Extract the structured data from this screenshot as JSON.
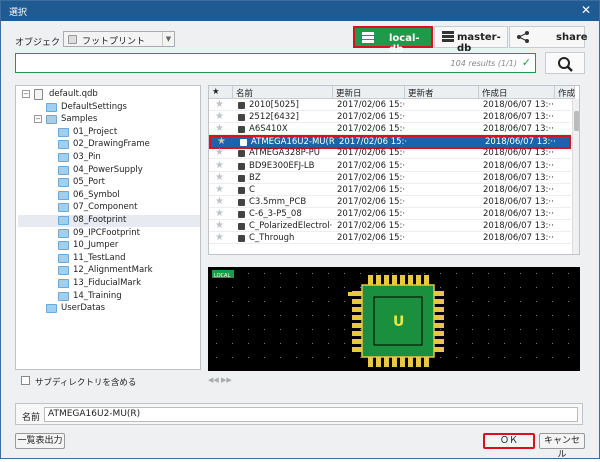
{
  "window": {
    "title": "選択",
    "close_glyph": "✕"
  },
  "object": {
    "label": "オブジェクト",
    "value": "フットプリント"
  },
  "db_buttons": {
    "local": {
      "label": "local-db",
      "sub": "LOCAL"
    },
    "master": {
      "label": "master-db",
      "sub": "MASTER"
    },
    "share": {
      "label": "share"
    }
  },
  "search": {
    "value": "",
    "result_count": "104 results (1/1)"
  },
  "tree": {
    "items": [
      {
        "label": "default.qdb",
        "level": 0,
        "kind": "db",
        "toggle": "−"
      },
      {
        "label": "DefaultSettings",
        "level": 1,
        "kind": "folder"
      },
      {
        "label": "Samples",
        "level": 1,
        "kind": "folder",
        "toggle": "−"
      },
      {
        "label": "01_Project",
        "level": 2,
        "kind": "folder"
      },
      {
        "label": "02_DrawingFrame",
        "level": 2,
        "kind": "folder"
      },
      {
        "label": "03_Pin",
        "level": 2,
        "kind": "folder"
      },
      {
        "label": "04_PowerSupply",
        "level": 2,
        "kind": "folder"
      },
      {
        "label": "05_Port",
        "level": 2,
        "kind": "folder"
      },
      {
        "label": "06_Symbol",
        "level": 2,
        "kind": "folder"
      },
      {
        "label": "07_Component",
        "level": 2,
        "kind": "folder"
      },
      {
        "label": "08_Footprint",
        "level": 2,
        "kind": "folder",
        "selected": true
      },
      {
        "label": "09_IPCFootprint",
        "level": 2,
        "kind": "folder"
      },
      {
        "label": "10_Jumper",
        "level": 2,
        "kind": "folder"
      },
      {
        "label": "11_TestLand",
        "level": 2,
        "kind": "folder"
      },
      {
        "label": "12_AlignmentMark",
        "level": 2,
        "kind": "folder"
      },
      {
        "label": "13_FiducialMark",
        "level": 2,
        "kind": "folder"
      },
      {
        "label": "14_Training",
        "level": 2,
        "kind": "folder"
      },
      {
        "label": "UserDatas",
        "level": 1,
        "kind": "folder"
      }
    ]
  },
  "subdir": {
    "label": "サブディレクトリを含める"
  },
  "table": {
    "headers": [
      "★",
      "名前",
      "更新日",
      "更新者",
      "作成日",
      "作成"
    ],
    "rows": [
      {
        "name": "2010[5025]",
        "updated": "2017/02/06 15:···",
        "updater": "",
        "created": "2018/06/07 13:···"
      },
      {
        "name": "2512[6432]",
        "updated": "2017/02/06 15:···",
        "updater": "",
        "created": "2018/06/07 13:···"
      },
      {
        "name": "A6S410X",
        "updated": "2017/02/06 15:···",
        "updater": "",
        "created": "2018/06/07 13:···"
      },
      {
        "name": "ATMEGA16U2-MU(R)",
        "updated": "2017/02/06 15:···",
        "updater": "",
        "created": "2018/06/07 13:···",
        "selected": true
      },
      {
        "name": "ATMEGA328P-PU",
        "updated": "2017/02/06 15:···",
        "updater": "",
        "created": "2018/06/07 13:···"
      },
      {
        "name": "BD9E300EFJ-LB",
        "updated": "2017/02/06 15:···",
        "updater": "",
        "created": "2018/06/07 13:···"
      },
      {
        "name": "BZ",
        "updated": "2017/02/06 15:···",
        "updater": "",
        "created": "2018/06/07 13:···"
      },
      {
        "name": "C",
        "updated": "2017/02/06 15:···",
        "updater": "",
        "created": "2018/06/07 13:···"
      },
      {
        "name": "C3.5mm_PCB",
        "updated": "2017/02/06 15:···",
        "updater": "",
        "created": "2018/06/07 13:···"
      },
      {
        "name": "C-6_3-P5_08",
        "updated": "2017/02/06 15:···",
        "updater": "",
        "created": "2018/06/07 13:···"
      },
      {
        "name": "C_PolarizedElectrol···",
        "updated": "2017/02/06 15:···",
        "updater": "",
        "created": "2018/06/07 13:···"
      },
      {
        "name": "C_Through",
        "updated": "2017/02/06 15:···",
        "updater": "",
        "created": "2018/06/07 13:···"
      }
    ]
  },
  "preview": {
    "badge": "LOCAL",
    "center_label": "U"
  },
  "name_field": {
    "label": "名前",
    "value": "ATMEGA16U2-MU(R)"
  },
  "buttons": {
    "export": "一覧表出力",
    "ok": "ＯＫ",
    "cancel": "キャンセル"
  },
  "colors": {
    "titlebar": "#1f5a92",
    "accent_green": "#1f9a4a",
    "highlight_red": "#d81020",
    "selection_blue": "#1e62a8"
  }
}
